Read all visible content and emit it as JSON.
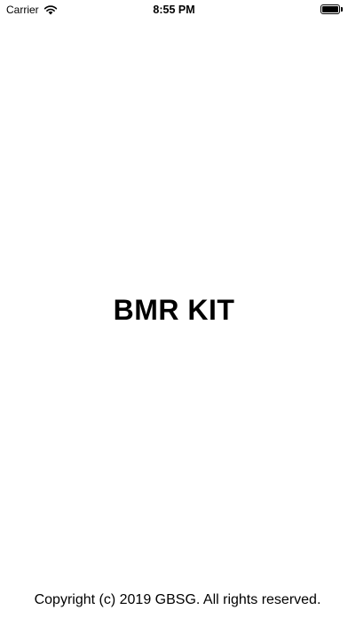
{
  "status_bar": {
    "carrier": "Carrier",
    "time": "8:55 PM",
    "wifi_icon": "wifi-icon",
    "battery_icon": "battery-icon",
    "battery_level": 1.0
  },
  "splash": {
    "title": "BMR KIT",
    "copyright": "Copyright (c) 2019 GBSG. All rights reserved."
  },
  "colors": {
    "background": "#ffffff",
    "text": "#000000"
  }
}
